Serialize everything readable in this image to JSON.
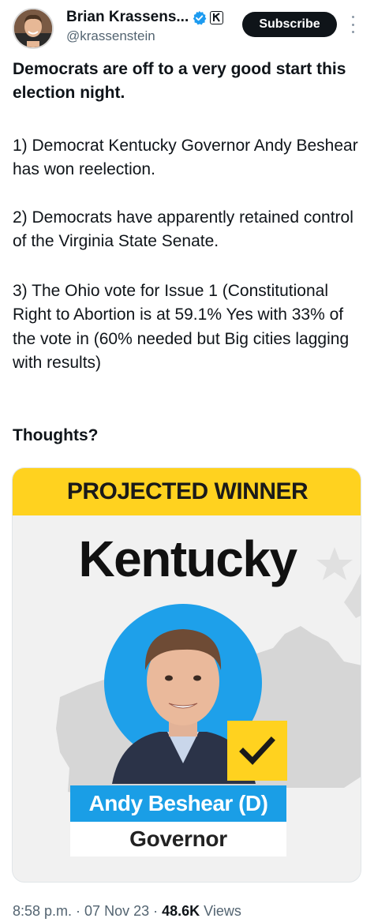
{
  "author": {
    "display_name": "Brian Krassens...",
    "handle": "@krassenstein",
    "subscribe_label": "Subscribe"
  },
  "icons": {
    "verified": "verified-badge-icon",
    "affiliation": "affiliation-badge-icon",
    "more": "more-options-icon",
    "check": "checkmark-icon"
  },
  "colors": {
    "verified_blue": "#1d9bf0",
    "banner_yellow": "#ffd21f",
    "name_blue": "#1a9ee6"
  },
  "tweet": {
    "headline": "Democrats are off to a very good start this election night.",
    "point1": "1) Democrat Kentucky Governor Andy Beshear has won reelection.",
    "point2": "2) Democrats have apparently retained control of the Virginia State Senate.",
    "point3": "3) The Ohio vote for Issue 1 (Constitutional Right to Abortion is at 59.1% Yes with 33% of the vote in (60% needed but Big cities lagging with results)",
    "closing": "Thoughts?"
  },
  "media": {
    "banner": "PROJECTED WINNER",
    "state": "Kentucky",
    "candidate": "Andy Beshear (D)",
    "office": "Governor"
  },
  "meta": {
    "time": "8:58 p.m.",
    "sep1": " · ",
    "date": "07 Nov 23",
    "sep2": " · ",
    "views_count": "48.6K",
    "views_label": " Views"
  }
}
